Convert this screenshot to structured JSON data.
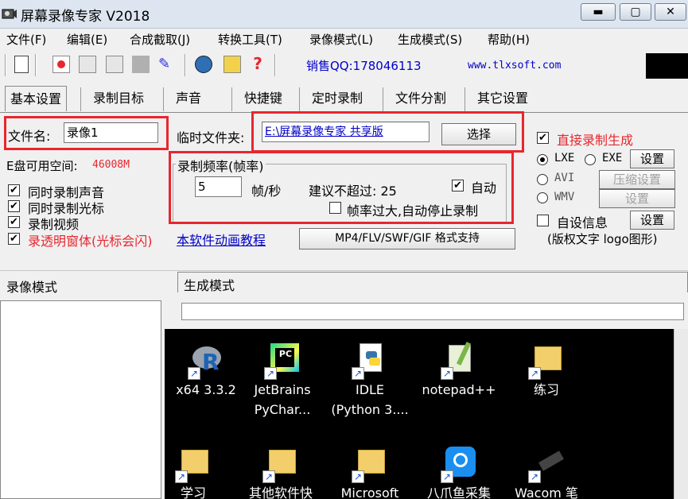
{
  "window": {
    "title": "屏幕录像专家 V2018",
    "min_label": "▬",
    "max_label": "▢",
    "close_label": "✕"
  },
  "menu": [
    "文件(F)",
    "编辑(E)",
    "合成截取(J)",
    "转换工具(T)",
    "录像模式(L)",
    "生成模式(S)",
    "帮助(H)"
  ],
  "toolbar": {
    "qq": "销售QQ:178046113",
    "site": "www.tlxsoft.com",
    "help_label": "?"
  },
  "tabs": [
    "基本设置",
    "录制目标",
    "声音",
    "快捷键",
    "定时录制",
    "文件分割",
    "其它设置"
  ],
  "basic": {
    "filename_label": "文件名:",
    "filename_value": "录像1",
    "tempfolder_label": "临时文件夹:",
    "tempfolder_value": "E:\\屏幕录像专家 共享版",
    "choose_button": "选择",
    "disk_label": "E盘可用空间:",
    "disk_value": "46008M",
    "checks": [
      {
        "label": "同时录制声音",
        "checked": true
      },
      {
        "label": "同时录制光标",
        "checked": true
      },
      {
        "label": "录制视频",
        "checked": true
      },
      {
        "label": "录透明窗体(光标会闪)",
        "checked": true
      }
    ],
    "tutorial_link": "本软件动画教程",
    "format_button": "MP4/FLV/SWF/GIF  格式支持"
  },
  "rate": {
    "group_title": "录制频率(帧率)",
    "fps_value": "5",
    "fps_unit": "帧/秒",
    "suggest": "建议不超过: 25",
    "auto_label": "自动",
    "auto_checked": true,
    "autostop_label": "帧率过大,自动停止录制",
    "autostop_checked": false
  },
  "output": {
    "direct_label": "直接录制生成",
    "direct_checked": true,
    "lxe": "LXE",
    "exe": "EXE",
    "avi": "AVI",
    "wmv": "WMV",
    "settings_button": "设置",
    "compress_button": "压缩设置",
    "settings2_button": "设置",
    "custom_label": "自设信息",
    "custom_checked": false,
    "settings3_button": "设置",
    "custom_note": "(版权文字 logo图形)"
  },
  "modes": {
    "record_mode": "录像模式",
    "generate_mode": "生成模式"
  },
  "desktop_icons": [
    {
      "line1": "x64 3.3.2",
      "line2": "",
      "icon": "r-icon"
    },
    {
      "line1": "JetBrains",
      "line2": "PyChar...",
      "icon": "pycharm-icon"
    },
    {
      "line1": "IDLE",
      "line2": "(Python 3....",
      "icon": "python-icon"
    },
    {
      "line1": "notepad++",
      "line2": "",
      "icon": "notepad-icon"
    },
    {
      "line1": "练习",
      "line2": "",
      "icon": "folder-icon"
    },
    {
      "line1": "学习",
      "line2": "",
      "icon": "folder-icon"
    },
    {
      "line1": "其他软件快",
      "line2": "",
      "icon": "folder-icon"
    },
    {
      "line1": "Microsoft",
      "line2": "",
      "icon": "folder-icon"
    },
    {
      "line1": "八爪鱼采集",
      "line2": "",
      "icon": "octopus-icon"
    },
    {
      "line1": "Wacom 笔",
      "line2": "",
      "icon": "wacom-icon"
    }
  ],
  "colors": {
    "red_frame": "#e8262e",
    "link": "#0000c8",
    "disk_value": "#e8262e"
  }
}
